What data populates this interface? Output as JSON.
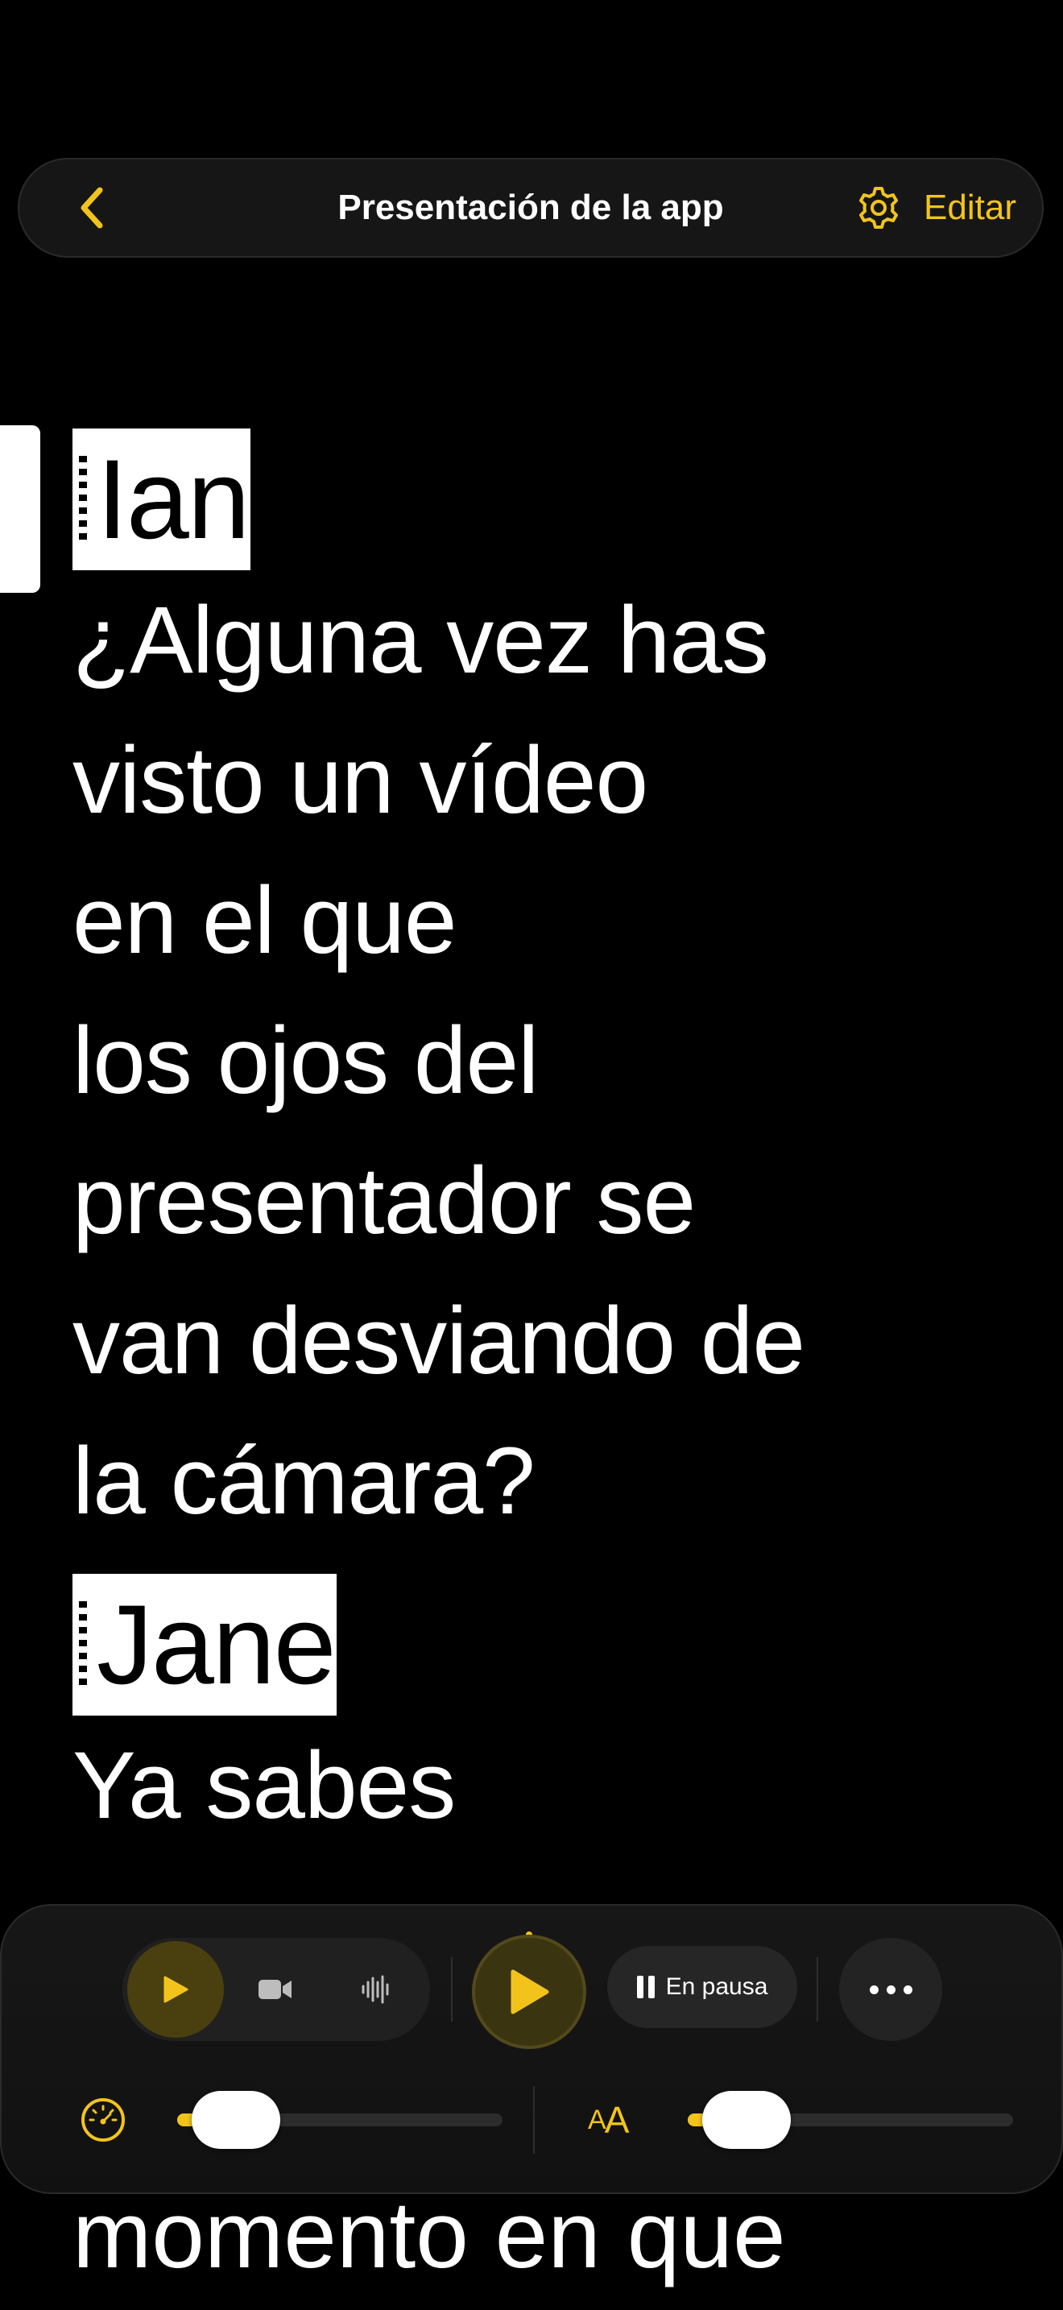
{
  "header": {
    "title": "Presentación de la app",
    "edit_label": "Editar",
    "icons": [
      "chevron-left-icon",
      "gear-icon"
    ]
  },
  "script": {
    "blocks": [
      {
        "speaker": "Ian",
        "lines": [
          "¿Alguna vez has",
          "visto un vídeo",
          "en el que",
          "los ojos del",
          "presentador se",
          "van desviando de",
          "la cámara?"
        ]
      },
      {
        "speaker": "Jane",
        "lines": [
          "Ya sabes"
        ]
      }
    ],
    "trailing_line": "momento en que"
  },
  "controls": {
    "status_label": "En pausa",
    "modes": [
      "play-mode-icon",
      "video-camera-icon",
      "audio-waveform-icon"
    ],
    "speed_slider": {
      "icon": "speedometer-icon",
      "value": 0.18
    },
    "text_size_slider": {
      "label_big": "A",
      "label_small": "A",
      "value": 0.18
    }
  },
  "colors": {
    "accent": "#f2c41b",
    "background": "#000000",
    "text": "#ffffff"
  }
}
